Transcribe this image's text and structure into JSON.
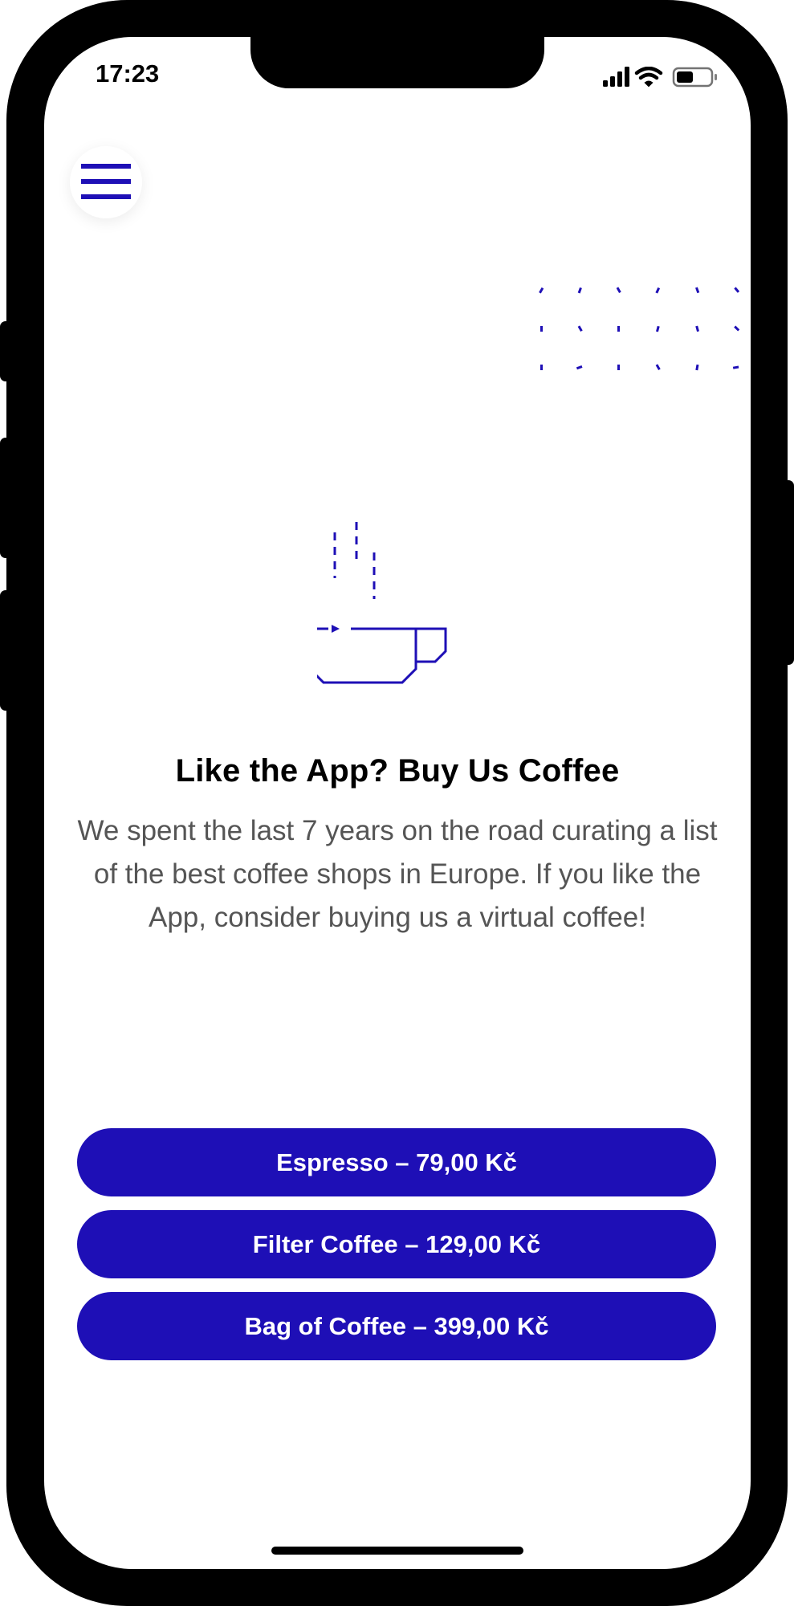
{
  "status_bar": {
    "time": "17:23",
    "icons": [
      "cellular-signal-icon",
      "wifi-icon",
      "battery-icon"
    ]
  },
  "header": {
    "menu_icon": "hamburger-menu-icon"
  },
  "illustration": {
    "icon": "coffee-cup-icon",
    "pattern": "dot-pattern"
  },
  "content": {
    "title": "Like the App? Buy Us Coffee",
    "description": "We spent the last 7 years on the road curating a list of the best coffee shops in Europe. If you like the App, consider buying us a virtual coffee!"
  },
  "purchase_options": [
    {
      "label": "Espresso – 79,00 Kč"
    },
    {
      "label": "Filter Coffee – 129,00 Kč"
    },
    {
      "label": "Bag of Coffee – 399,00 Kč"
    }
  ],
  "colors": {
    "accent": "#1e0fb6",
    "text_primary": "#000000",
    "text_secondary": "#555555",
    "background": "#ffffff"
  }
}
